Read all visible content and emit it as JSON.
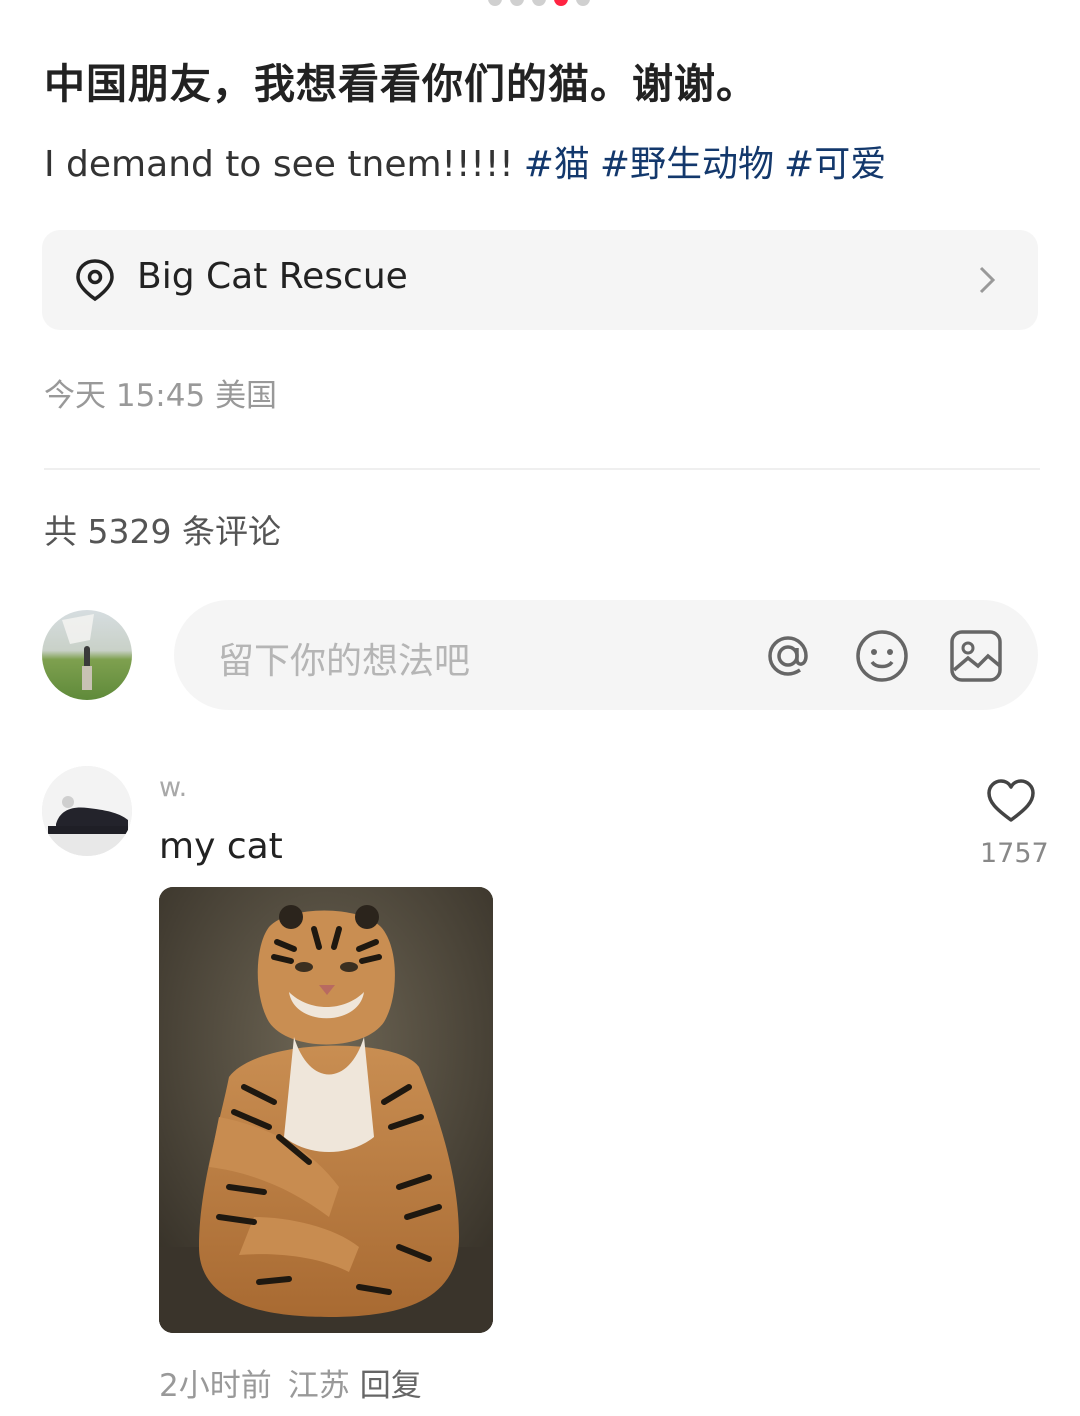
{
  "post": {
    "title": "中国朋友，我想看看你们的猫。谢谢。",
    "text": "I demand to see tnem!!!!!",
    "tags": [
      "#猫",
      "#野生动物",
      "#可爱"
    ],
    "location": "Big Cat Rescue",
    "time": "今天 15:45",
    "region": "美国"
  },
  "comments_header": {
    "count_text": "共 5329 条评论"
  },
  "comment_input": {
    "placeholder": "留下你的想法吧",
    "icons": [
      "at-icon",
      "emoji-icon",
      "image-icon"
    ]
  },
  "comment": {
    "user": "w.",
    "text": "my cat",
    "likes": "1757",
    "time": "2小时前",
    "region": "江苏",
    "reply_label": "回复"
  },
  "colors": {
    "accent": "#ff2442",
    "tag": "#13386c",
    "muted": "#999999"
  }
}
